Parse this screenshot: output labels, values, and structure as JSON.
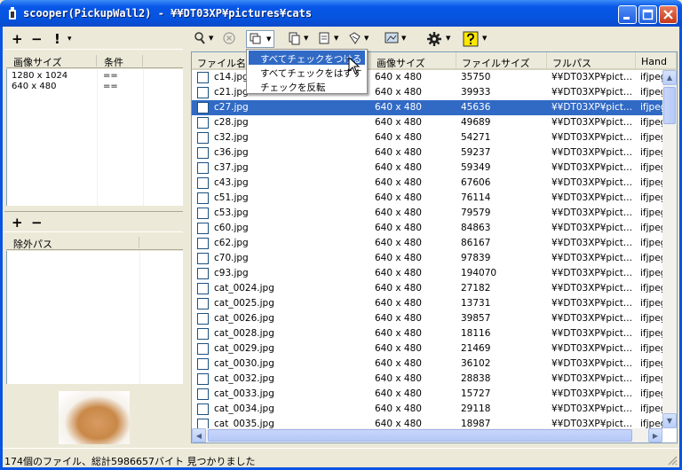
{
  "window": {
    "title": "scooper(PickupWall2) - ¥¥DT03XP¥pictures¥cats"
  },
  "left_top": {
    "toolbar": [
      "+",
      "−",
      "!",
      "▾"
    ],
    "headers": [
      "画像サイズ",
      "条件"
    ],
    "rows": [
      {
        "size": "1280 x 1024",
        "cond": "=="
      },
      {
        "size": "640 x 480",
        "cond": "=="
      }
    ]
  },
  "left_bottom": {
    "toolbar": [
      "+",
      "−"
    ],
    "header": "除外パス"
  },
  "columns": [
    "ファイル名",
    "画像サイズ",
    "ファイルサイズ",
    "フルパス",
    "Hand"
  ],
  "files": [
    {
      "name": "c14.jpg",
      "dims": "640 x 480",
      "size": "35750",
      "path": "¥¥DT03XP¥pict...",
      "handler": "ifjpeg..."
    },
    {
      "name": "c21.jpg",
      "dims": "640 x 480",
      "size": "39933",
      "path": "¥¥DT03XP¥pict...",
      "handler": "ifjpeg..."
    },
    {
      "name": "c27.jpg",
      "dims": "640 x 480",
      "size": "45636",
      "path": "¥¥DT03XP¥pict...",
      "handler": "ifjpeg..."
    },
    {
      "name": "c28.jpg",
      "dims": "640 x 480",
      "size": "49689",
      "path": "¥¥DT03XP¥pict...",
      "handler": "ifjpeg..."
    },
    {
      "name": "c32.jpg",
      "dims": "640 x 480",
      "size": "54271",
      "path": "¥¥DT03XP¥pict...",
      "handler": "ifjpeg..."
    },
    {
      "name": "c36.jpg",
      "dims": "640 x 480",
      "size": "59237",
      "path": "¥¥DT03XP¥pict...",
      "handler": "ifjpeg..."
    },
    {
      "name": "c37.jpg",
      "dims": "640 x 480",
      "size": "59349",
      "path": "¥¥DT03XP¥pict...",
      "handler": "ifjpeg..."
    },
    {
      "name": "c43.jpg",
      "dims": "640 x 480",
      "size": "67606",
      "path": "¥¥DT03XP¥pict...",
      "handler": "ifjpeg..."
    },
    {
      "name": "c51.jpg",
      "dims": "640 x 480",
      "size": "76114",
      "path": "¥¥DT03XP¥pict...",
      "handler": "ifjpeg..."
    },
    {
      "name": "c53.jpg",
      "dims": "640 x 480",
      "size": "79579",
      "path": "¥¥DT03XP¥pict...",
      "handler": "ifjpeg..."
    },
    {
      "name": "c60.jpg",
      "dims": "640 x 480",
      "size": "84863",
      "path": "¥¥DT03XP¥pict...",
      "handler": "ifjpeg..."
    },
    {
      "name": "c62.jpg",
      "dims": "640 x 480",
      "size": "86167",
      "path": "¥¥DT03XP¥pict...",
      "handler": "ifjpeg..."
    },
    {
      "name": "c70.jpg",
      "dims": "640 x 480",
      "size": "97839",
      "path": "¥¥DT03XP¥pict...",
      "handler": "ifjpeg..."
    },
    {
      "name": "c93.jpg",
      "dims": "640 x 480",
      "size": "194070",
      "path": "¥¥DT03XP¥pict...",
      "handler": "ifjpeg..."
    },
    {
      "name": "cat_0024.jpg",
      "dims": "640 x 480",
      "size": "27182",
      "path": "¥¥DT03XP¥pict...",
      "handler": "ifjpeg..."
    },
    {
      "name": "cat_0025.jpg",
      "dims": "640 x 480",
      "size": "13731",
      "path": "¥¥DT03XP¥pict...",
      "handler": "ifjpeg..."
    },
    {
      "name": "cat_0026.jpg",
      "dims": "640 x 480",
      "size": "39857",
      "path": "¥¥DT03XP¥pict...",
      "handler": "ifjpeg..."
    },
    {
      "name": "cat_0028.jpg",
      "dims": "640 x 480",
      "size": "18116",
      "path": "¥¥DT03XP¥pict...",
      "handler": "ifjpeg..."
    },
    {
      "name": "cat_0029.jpg",
      "dims": "640 x 480",
      "size": "21469",
      "path": "¥¥DT03XP¥pict...",
      "handler": "ifjpeg..."
    },
    {
      "name": "cat_0030.jpg",
      "dims": "640 x 480",
      "size": "36102",
      "path": "¥¥DT03XP¥pict...",
      "handler": "ifjpeg..."
    },
    {
      "name": "cat_0032.jpg",
      "dims": "640 x 480",
      "size": "28838",
      "path": "¥¥DT03XP¥pict...",
      "handler": "ifjpeg..."
    },
    {
      "name": "cat_0033.jpg",
      "dims": "640 x 480",
      "size": "15727",
      "path": "¥¥DT03XP¥pict...",
      "handler": "ifjpeg..."
    },
    {
      "name": "cat_0034.jpg",
      "dims": "640 x 480",
      "size": "29118",
      "path": "¥¥DT03XP¥pict...",
      "handler": "ifjpeg..."
    },
    {
      "name": "cat_0035.jpg",
      "dims": "640 x 480",
      "size": "18987",
      "path": "¥¥DT03XP¥pict...",
      "handler": "ifjpeg..."
    }
  ],
  "selected_file": "c27.jpg",
  "menu": {
    "items": [
      "すべてチェックをつける",
      "すべてチェックをはずす",
      "チェックを反転"
    ],
    "highlighted": "すべてチェックをつける"
  },
  "toolbar": {
    "icons": [
      "search-icon",
      "stop-icon",
      "check-menu-icon",
      "copy-icon",
      "move-icon",
      "delete-icon",
      "view-icon",
      "settings-gear-icon",
      "help-icon"
    ]
  },
  "status": {
    "text": "174個のファイル、総計5986657バイト 見つかりました"
  },
  "colors": {
    "titlebar": "#0653de",
    "selection": "#316ac5",
    "face": "#ece9d8"
  }
}
